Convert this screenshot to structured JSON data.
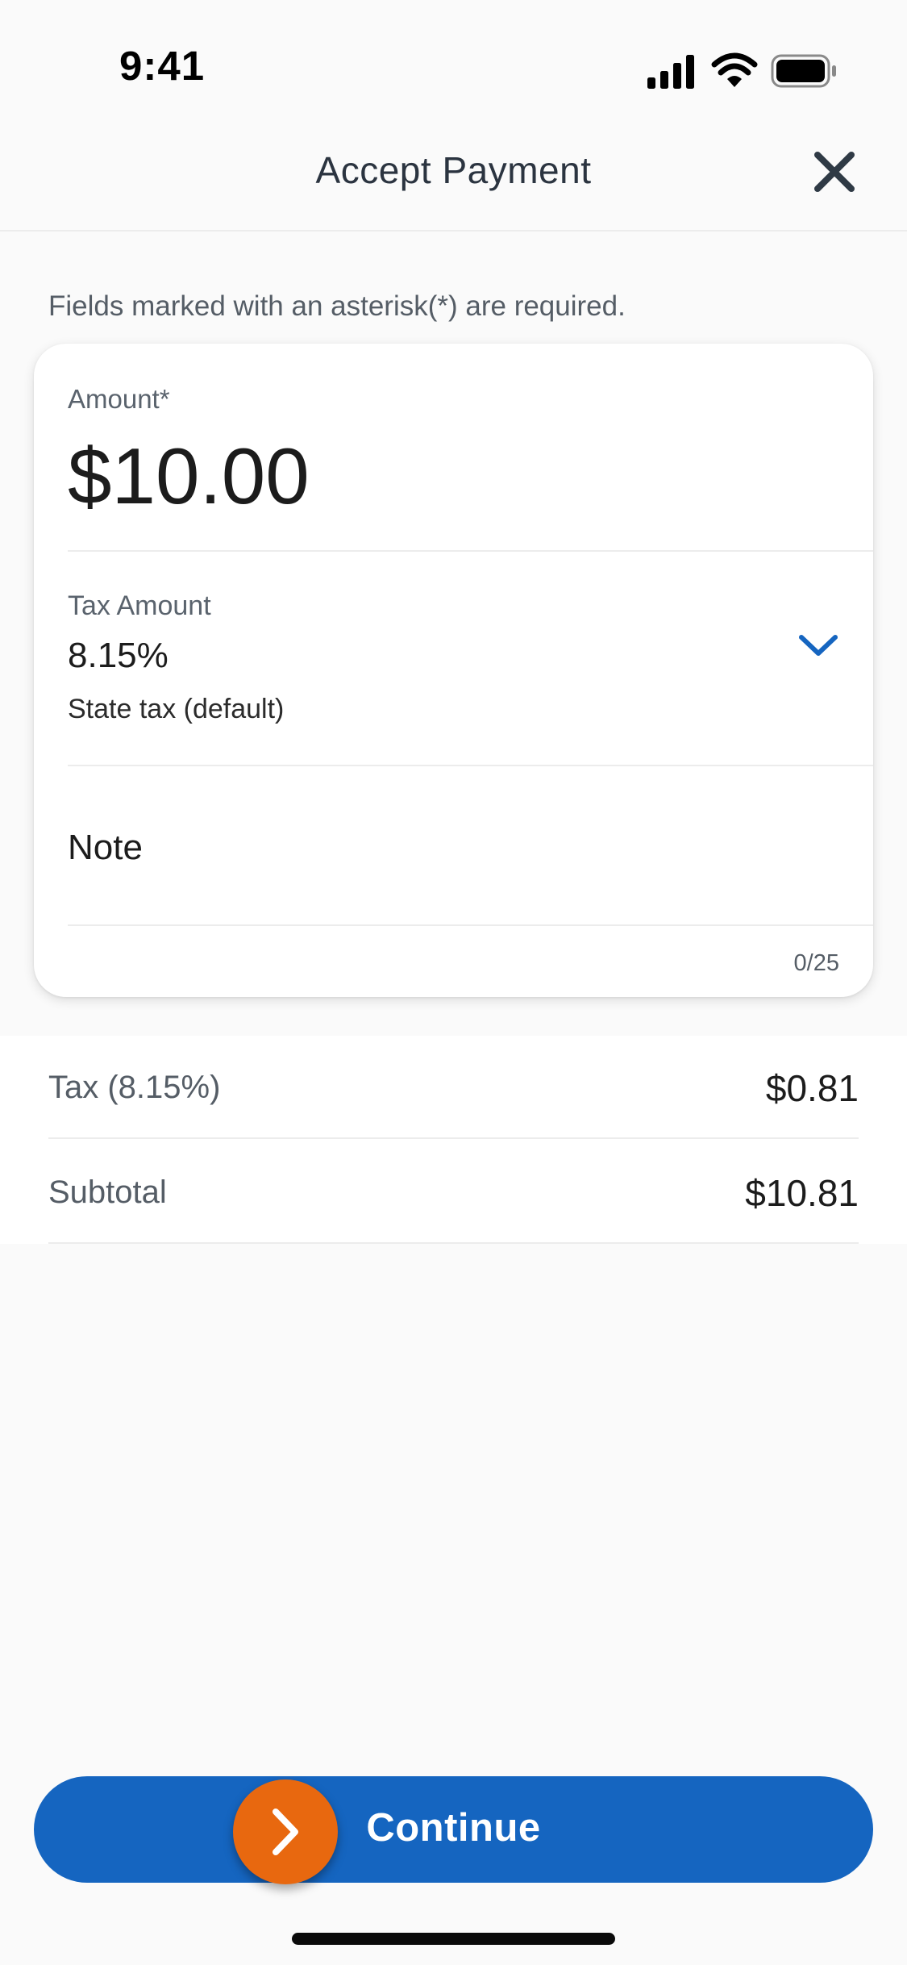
{
  "status_bar": {
    "time": "9:41",
    "icons": [
      "signal-icon",
      "wifi-icon",
      "battery-icon"
    ]
  },
  "header": {
    "title": "Accept Payment",
    "close_icon": "close-icon"
  },
  "form": {
    "required_note": "Fields marked with an asterisk(*) are required.",
    "amount": {
      "label": "Amount*",
      "value": "$10.00"
    },
    "tax": {
      "label": "Tax Amount",
      "value": "8.15%",
      "description": "State tax (default)",
      "dropdown_icon": "chevron-down-icon"
    },
    "note": {
      "placeholder": "Note",
      "value": "",
      "counter": "0/25"
    }
  },
  "summary": {
    "rows": [
      {
        "label": "Tax (8.15%)",
        "value": "$0.81"
      },
      {
        "label": "Subtotal",
        "value": "$10.81"
      }
    ]
  },
  "footer": {
    "continue_label": "Continue",
    "badge_icon": "chevron-right-icon"
  },
  "colors": {
    "primary": "#1565c0",
    "accent": "#e8680f",
    "background": "#fafafa"
  }
}
